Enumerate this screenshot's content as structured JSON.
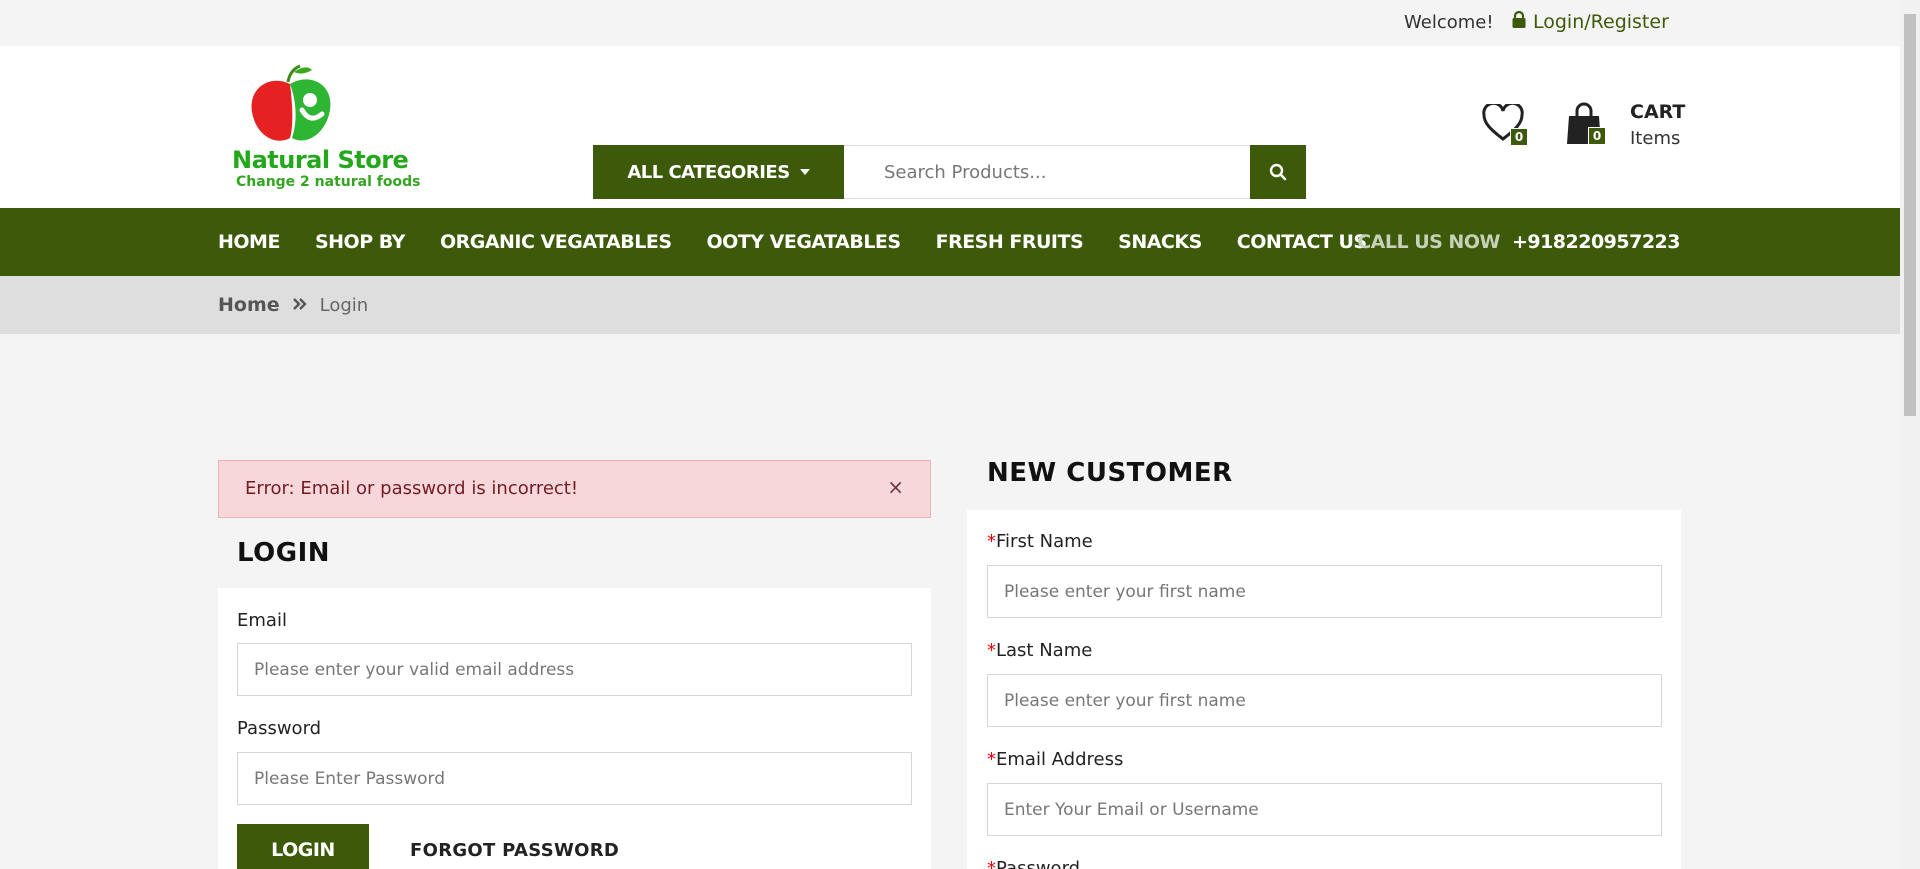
{
  "topbar": {
    "welcome": "Welcome!",
    "login_register": "Login/Register"
  },
  "logo": {
    "brand": "Natural Store",
    "tagline": "Change 2 natural foods"
  },
  "search": {
    "categories_label": "ALL CATEGORIES",
    "placeholder": "Search Products..."
  },
  "header_icons": {
    "wishlist_count": "0",
    "cart_count": "0",
    "cart_title": "CART",
    "cart_items": "Items"
  },
  "nav": {
    "items": [
      "HOME",
      "SHOP BY",
      "ORGANIC VEGATABLES",
      "OOTY VEGATABLES",
      "FRESH FRUITS",
      "SNACKS",
      "CONTACT US"
    ],
    "call_label": "CALL US NOW",
    "call_number": "+918220957223"
  },
  "breadcrumb": {
    "home": "Home",
    "current": "Login"
  },
  "alert": {
    "message": "Error: Email or password is incorrect!",
    "close": "×"
  },
  "login": {
    "title": "LOGIN",
    "email_label": "Email",
    "email_placeholder": "Please enter your valid email address",
    "password_label": "Password",
    "password_placeholder": "Please Enter Password",
    "login_button": "LOGIN",
    "forgot_password": "FORGOT PASSWORD"
  },
  "new_customer": {
    "title": "NEW CUSTOMER",
    "required_mark": "*",
    "first_name_label": "First Name",
    "first_name_placeholder": "Please enter your first name",
    "last_name_label": "Last Name",
    "last_name_placeholder": "Please enter your first name",
    "email_label": "Email Address",
    "email_placeholder": "Enter Your Email or Username",
    "password_label": "Password"
  },
  "colors": {
    "brand_green": "#3d5a0a",
    "alert_bg": "#f8d7da",
    "required": "#ee0000"
  }
}
